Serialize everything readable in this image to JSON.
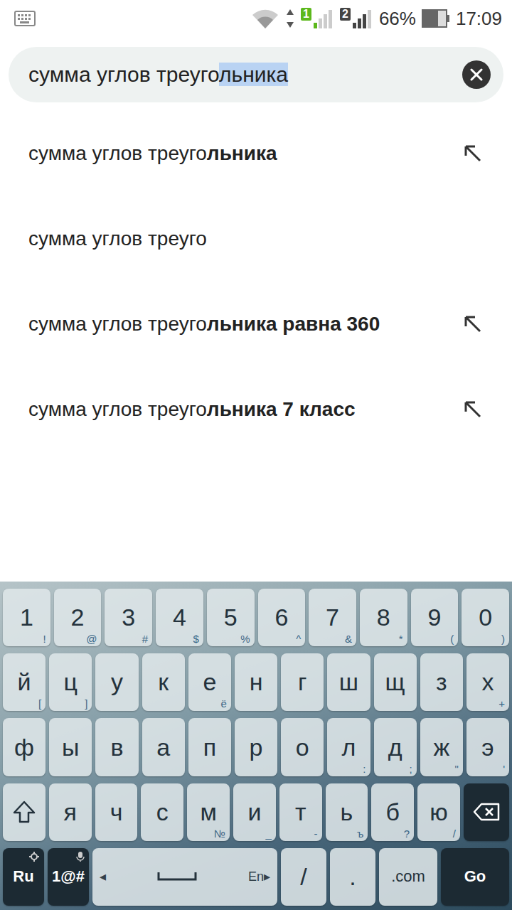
{
  "status_bar": {
    "sims": [
      {
        "label": "1",
        "active": true
      },
      {
        "label": "2",
        "active": false
      }
    ],
    "battery": "66%",
    "battery_level": 0.66,
    "time": "17:09"
  },
  "search": {
    "typed": "сумма углов треуго",
    "completion": "льника",
    "completion_selected": true
  },
  "suggestions": [
    {
      "plain": "сумма углов треуго",
      "bold": "льника",
      "fill_arrow": true
    },
    {
      "plain": "сумма углов треуго",
      "bold": "",
      "fill_arrow": false
    },
    {
      "plain": "сумма углов треуго",
      "bold": "льника равна 360",
      "fill_arrow": true
    },
    {
      "plain": "сумма углов треуго",
      "bold": "льника 7 класс",
      "fill_arrow": true
    }
  ],
  "keyboard": {
    "rows": [
      [
        {
          "kind": "char",
          "label": "1",
          "hint": "!"
        },
        {
          "kind": "char",
          "label": "2",
          "hint": "@"
        },
        {
          "kind": "char",
          "label": "3",
          "hint": "#"
        },
        {
          "kind": "char",
          "label": "4",
          "hint": "$"
        },
        {
          "kind": "char",
          "label": "5",
          "hint": "%"
        },
        {
          "kind": "char",
          "label": "6",
          "hint": "^"
        },
        {
          "kind": "char",
          "label": "7",
          "hint": "&"
        },
        {
          "kind": "char",
          "label": "8",
          "hint": "*"
        },
        {
          "kind": "char",
          "label": "9",
          "hint": "("
        },
        {
          "kind": "char",
          "label": "0",
          "hint": ")"
        }
      ],
      [
        {
          "kind": "char",
          "label": "й",
          "hint": "["
        },
        {
          "kind": "char",
          "label": "ц",
          "hint": "]"
        },
        {
          "kind": "char",
          "label": "у",
          "hint": ""
        },
        {
          "kind": "char",
          "label": "к",
          "hint": ""
        },
        {
          "kind": "char",
          "label": "е",
          "hint": "ё"
        },
        {
          "kind": "char",
          "label": "н",
          "hint": ""
        },
        {
          "kind": "char",
          "label": "г",
          "hint": ""
        },
        {
          "kind": "char",
          "label": "ш",
          "hint": ""
        },
        {
          "kind": "char",
          "label": "щ",
          "hint": ""
        },
        {
          "kind": "char",
          "label": "з",
          "hint": ""
        },
        {
          "kind": "char",
          "label": "х",
          "hint": "+"
        }
      ],
      [
        {
          "kind": "char",
          "label": "ф",
          "hint": ""
        },
        {
          "kind": "char",
          "label": "ы",
          "hint": ""
        },
        {
          "kind": "char",
          "label": "в",
          "hint": ""
        },
        {
          "kind": "char",
          "label": "а",
          "hint": ""
        },
        {
          "kind": "char",
          "label": "п",
          "hint": ""
        },
        {
          "kind": "char",
          "label": "р",
          "hint": ""
        },
        {
          "kind": "char",
          "label": "о",
          "hint": ""
        },
        {
          "kind": "char",
          "label": "л",
          "hint": ":"
        },
        {
          "kind": "char",
          "label": "д",
          "hint": ";"
        },
        {
          "kind": "char",
          "label": "ж",
          "hint": "\""
        },
        {
          "kind": "char",
          "label": "э",
          "hint": "'"
        }
      ],
      [
        {
          "kind": "shift",
          "label": "",
          "hint": ""
        },
        {
          "kind": "char",
          "label": "я",
          "hint": ""
        },
        {
          "kind": "char",
          "label": "ч",
          "hint": ""
        },
        {
          "kind": "char",
          "label": "с",
          "hint": ""
        },
        {
          "kind": "char",
          "label": "м",
          "hint": "№"
        },
        {
          "kind": "char",
          "label": "и",
          "hint": "_"
        },
        {
          "kind": "char",
          "label": "т",
          "hint": "-"
        },
        {
          "kind": "char",
          "label": "ь",
          "hint": "ъ"
        },
        {
          "kind": "char",
          "label": "б",
          "hint": "?"
        },
        {
          "kind": "char",
          "label": "ю",
          "hint": "/"
        },
        {
          "kind": "backspace",
          "label": "",
          "hint": ""
        }
      ],
      [
        {
          "kind": "mode",
          "label": "Ru",
          "hint": ""
        },
        {
          "kind": "mode",
          "label": "1@#",
          "hint": ""
        },
        {
          "kind": "space",
          "label": "◂",
          "hint": "En▸"
        },
        {
          "kind": "narrow",
          "label": "/",
          "hint": ""
        },
        {
          "kind": "narrow",
          "label": ".",
          "hint": ""
        },
        {
          "kind": "com",
          "label": ".com",
          "hint": ""
        },
        {
          "kind": "go",
          "label": "Go",
          "hint": ""
        }
      ]
    ]
  }
}
